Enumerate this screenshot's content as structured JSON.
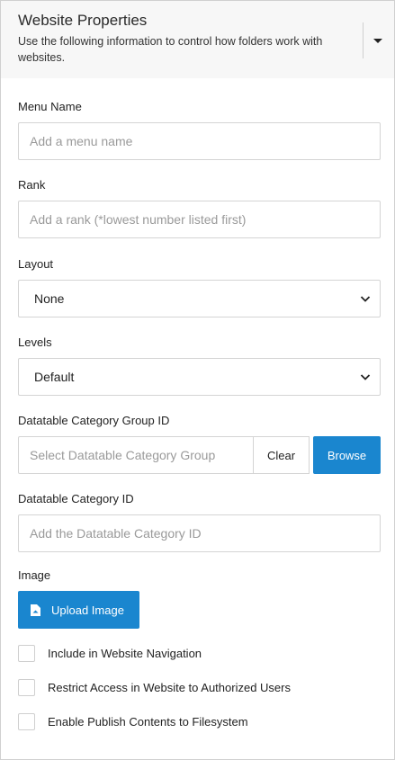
{
  "header": {
    "title": "Website Properties",
    "description": "Use the following information to control how folders work with websites.",
    "toggle_icon": "caret-down-icon"
  },
  "fields": {
    "menu_name": {
      "label": "Menu Name",
      "placeholder": "Add a menu name",
      "value": ""
    },
    "rank": {
      "label": "Rank",
      "placeholder": "Add a rank (*lowest number listed first)",
      "value": ""
    },
    "layout": {
      "label": "Layout",
      "selected": "None"
    },
    "levels": {
      "label": "Levels",
      "selected": "Default"
    },
    "category_group": {
      "label": "Datatable Category Group ID",
      "placeholder": "Select Datatable Category Group",
      "clear_label": "Clear",
      "browse_label": "Browse"
    },
    "category_id": {
      "label": "Datatable Category ID",
      "placeholder": "Add the Datatable Category ID",
      "value": ""
    },
    "image": {
      "label": "Image",
      "upload_label": "Upload Image"
    }
  },
  "checkboxes": [
    {
      "label": "Include in Website Navigation",
      "checked": false
    },
    {
      "label": "Restrict Access in Website to Authorized Users",
      "checked": false
    },
    {
      "label": "Enable Publish Contents to Filesystem",
      "checked": false
    }
  ],
  "colors": {
    "accent": "#1a86cf",
    "header_bg": "#f7f7f7",
    "border": "#d4d4d4",
    "placeholder": "#9a9a9a"
  }
}
